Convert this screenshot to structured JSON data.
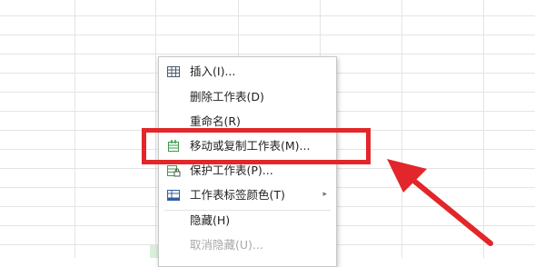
{
  "menu": {
    "items": [
      {
        "label": "插入(I)...",
        "icon": "insert-table-icon",
        "disabled": false
      },
      {
        "label": "删除工作表(D)",
        "icon": "",
        "disabled": false
      },
      {
        "label": "重命名(R)",
        "icon": "",
        "disabled": false
      },
      {
        "label": "移动或复制工作表(M)...",
        "icon": "move-copy-sheet-icon",
        "disabled": false
      },
      {
        "label": "保护工作表(P)...",
        "icon": "protect-sheet-icon",
        "disabled": false
      },
      {
        "label": "工作表标签颜色(T)",
        "icon": "tab-color-icon",
        "disabled": false,
        "submenu_arrow": "▸"
      },
      {
        "label": "隐藏(H)",
        "icon": "",
        "disabled": false
      },
      {
        "label": "取消隐藏(U)...",
        "icon": "",
        "disabled": true
      }
    ]
  },
  "colors": {
    "annotation_red": "#e2262a",
    "icon_green": "#3a9a4a",
    "icon_blue": "#2f5f9e"
  }
}
